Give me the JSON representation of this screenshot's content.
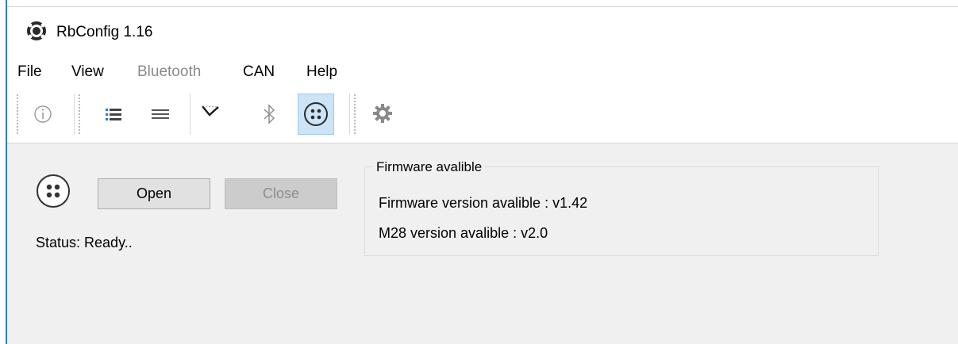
{
  "window": {
    "title": "RbConfig 1.16"
  },
  "menu": {
    "items": [
      {
        "label": "File",
        "enabled": true
      },
      {
        "label": "View",
        "enabled": true
      },
      {
        "label": "Bluetooth",
        "enabled": false
      },
      {
        "label": "CAN",
        "enabled": true
      },
      {
        "label": "Help",
        "enabled": true
      }
    ]
  },
  "toolbar": {
    "buttons": [
      {
        "icon": "info-icon"
      },
      {
        "icon": "list-detail-icon"
      },
      {
        "icon": "list-icon"
      },
      {
        "icon": "can-bus-icon"
      },
      {
        "icon": "bluetooth-icon"
      },
      {
        "icon": "connector-icon",
        "active": true
      },
      {
        "icon": "settings-gear-icon"
      }
    ]
  },
  "connection": {
    "open_label": "Open",
    "close_label": "Close",
    "status": "Status: Ready.."
  },
  "firmware": {
    "group_title": "Firmware avalible",
    "firmware_line": "Firmware version avalible : v1.42",
    "m28_line": "M28 version avalible : v2.0"
  },
  "colors": {
    "active_tool_bg": "#cce4f7",
    "active_tool_border": "#99c9ef",
    "window_accent": "#2b7fd6"
  }
}
